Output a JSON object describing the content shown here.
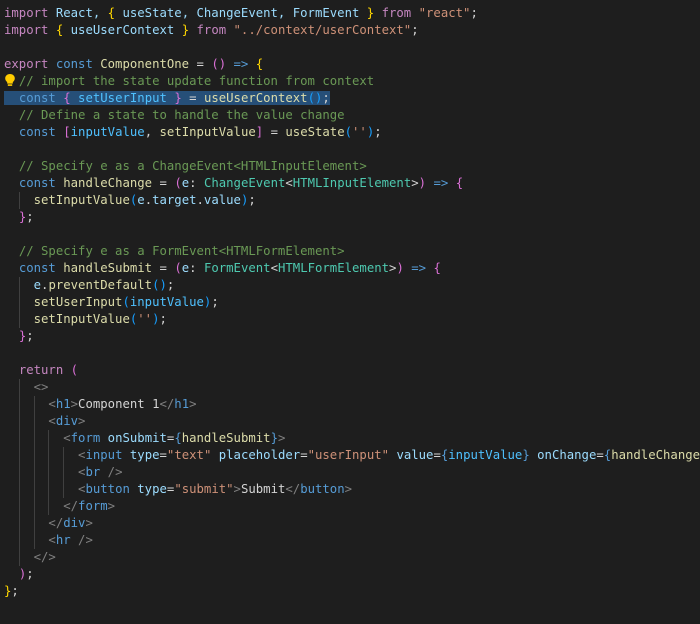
{
  "editor": {
    "lines": [
      [
        {
          "t": "import",
          "c": "kw"
        },
        {
          "t": " React, ",
          "c": "var"
        },
        {
          "t": "{",
          "c": "b1"
        },
        {
          "t": " useState, ChangeEvent, FormEvent ",
          "c": "var"
        },
        {
          "t": "}",
          "c": "b1"
        },
        {
          "t": " from ",
          "c": "kw"
        },
        {
          "t": "\"react\"",
          "c": "str"
        },
        {
          "t": ";",
          "c": "pn"
        }
      ],
      [
        {
          "t": "import",
          "c": "kw"
        },
        {
          "t": " ",
          "c": "pn"
        },
        {
          "t": "{",
          "c": "b1"
        },
        {
          "t": " useUserContext ",
          "c": "var"
        },
        {
          "t": "}",
          "c": "b1"
        },
        {
          "t": " from ",
          "c": "kw"
        },
        {
          "t": "\"../context/userContext\"",
          "c": "str"
        },
        {
          "t": ";",
          "c": "pn"
        }
      ],
      [],
      [
        {
          "t": "export",
          "c": "kw"
        },
        {
          "t": " const ",
          "c": "st"
        },
        {
          "t": "ComponentOne",
          "c": "fn"
        },
        {
          "t": " = ",
          "c": "pn"
        },
        {
          "t": "()",
          "c": "b2"
        },
        {
          "t": " => ",
          "c": "st"
        },
        {
          "t": "{",
          "c": "b1"
        }
      ],
      [
        {
          "t": "  ",
          "c": "pn",
          "bulb": true
        },
        {
          "t": "// import the state update function from context",
          "c": "cm"
        }
      ],
      [
        {
          "t": "  ",
          "c": "pn",
          "sel": true
        },
        {
          "t": "const",
          "c": "st",
          "sel": true
        },
        {
          "t": " ",
          "c": "pn",
          "sel": true
        },
        {
          "t": "{",
          "c": "b2",
          "sel": true
        },
        {
          "t": " setUserInput ",
          "c": "cst",
          "sel": true
        },
        {
          "t": "}",
          "c": "b2",
          "sel": true
        },
        {
          "t": " = ",
          "c": "pn",
          "sel": true
        },
        {
          "t": "useUserContext",
          "c": "fn",
          "sel": true
        },
        {
          "t": "()",
          "c": "b3",
          "sel": true
        },
        {
          "t": ";",
          "c": "pn",
          "sel": true
        }
      ],
      [
        {
          "t": "  ",
          "c": "pn"
        },
        {
          "t": "// Define a state to handle the value change",
          "c": "cm"
        }
      ],
      [
        {
          "t": "  ",
          "c": "pn"
        },
        {
          "t": "const",
          "c": "st"
        },
        {
          "t": " ",
          "c": "pn"
        },
        {
          "t": "[",
          "c": "b2"
        },
        {
          "t": "inputValue",
          "c": "cst"
        },
        {
          "t": ", ",
          "c": "pn"
        },
        {
          "t": "setInputValue",
          "c": "fn"
        },
        {
          "t": "]",
          "c": "b2"
        },
        {
          "t": " = ",
          "c": "pn"
        },
        {
          "t": "useState",
          "c": "fn"
        },
        {
          "t": "(",
          "c": "b3"
        },
        {
          "t": "''",
          "c": "str"
        },
        {
          "t": ")",
          "c": "b3"
        },
        {
          "t": ";",
          "c": "pn"
        }
      ],
      [],
      [
        {
          "t": "  ",
          "c": "pn"
        },
        {
          "t": "// Specify e as a ChangeEvent<HTMLInputElement>",
          "c": "cm"
        }
      ],
      [
        {
          "t": "  ",
          "c": "pn"
        },
        {
          "t": "const",
          "c": "st"
        },
        {
          "t": " ",
          "c": "pn"
        },
        {
          "t": "handleChange",
          "c": "fn"
        },
        {
          "t": " = ",
          "c": "pn"
        },
        {
          "t": "(",
          "c": "b2"
        },
        {
          "t": "e",
          "c": "var"
        },
        {
          "t": ": ",
          "c": "pn"
        },
        {
          "t": "ChangeEvent",
          "c": "ty"
        },
        {
          "t": "<",
          "c": "pn"
        },
        {
          "t": "HTMLInputElement",
          "c": "ty"
        },
        {
          "t": ">",
          "c": "pn"
        },
        {
          "t": ")",
          "c": "b2"
        },
        {
          "t": " => ",
          "c": "st"
        },
        {
          "t": "{",
          "c": "b2"
        }
      ],
      [
        {
          "t": "    ",
          "c": "pn"
        },
        {
          "t": "setInputValue",
          "c": "fn"
        },
        {
          "t": "(",
          "c": "b3"
        },
        {
          "t": "e",
          "c": "var"
        },
        {
          "t": ".",
          "c": "pn"
        },
        {
          "t": "target",
          "c": "var"
        },
        {
          "t": ".",
          "c": "pn"
        },
        {
          "t": "value",
          "c": "var"
        },
        {
          "t": ")",
          "c": "b3"
        },
        {
          "t": ";",
          "c": "pn"
        }
      ],
      [
        {
          "t": "  ",
          "c": "pn"
        },
        {
          "t": "}",
          "c": "b2"
        },
        {
          "t": ";",
          "c": "pn"
        }
      ],
      [],
      [
        {
          "t": "  ",
          "c": "pn"
        },
        {
          "t": "// Specify e as a FormEvent<HTMLFormElement>",
          "c": "cm"
        }
      ],
      [
        {
          "t": "  ",
          "c": "pn"
        },
        {
          "t": "const",
          "c": "st"
        },
        {
          "t": " ",
          "c": "pn"
        },
        {
          "t": "handleSubmit",
          "c": "fn"
        },
        {
          "t": " = ",
          "c": "pn"
        },
        {
          "t": "(",
          "c": "b2"
        },
        {
          "t": "e",
          "c": "var"
        },
        {
          "t": ": ",
          "c": "pn"
        },
        {
          "t": "FormEvent",
          "c": "ty"
        },
        {
          "t": "<",
          "c": "pn"
        },
        {
          "t": "HTMLFormElement",
          "c": "ty"
        },
        {
          "t": ">",
          "c": "pn"
        },
        {
          "t": ")",
          "c": "b2"
        },
        {
          "t": " => ",
          "c": "st"
        },
        {
          "t": "{",
          "c": "b2"
        }
      ],
      [
        {
          "t": "    ",
          "c": "pn"
        },
        {
          "t": "e",
          "c": "var"
        },
        {
          "t": ".",
          "c": "pn"
        },
        {
          "t": "preventDefault",
          "c": "fn"
        },
        {
          "t": "()",
          "c": "b3"
        },
        {
          "t": ";",
          "c": "pn"
        }
      ],
      [
        {
          "t": "    ",
          "c": "pn"
        },
        {
          "t": "setUserInput",
          "c": "fn"
        },
        {
          "t": "(",
          "c": "b3"
        },
        {
          "t": "inputValue",
          "c": "cst"
        },
        {
          "t": ")",
          "c": "b3"
        },
        {
          "t": ";",
          "c": "pn"
        }
      ],
      [
        {
          "t": "    ",
          "c": "pn"
        },
        {
          "t": "setInputValue",
          "c": "fn"
        },
        {
          "t": "(",
          "c": "b3"
        },
        {
          "t": "''",
          "c": "str"
        },
        {
          "t": ")",
          "c": "b3"
        },
        {
          "t": ";",
          "c": "pn"
        }
      ],
      [
        {
          "t": "  ",
          "c": "pn"
        },
        {
          "t": "}",
          "c": "b2"
        },
        {
          "t": ";",
          "c": "pn"
        }
      ],
      [],
      [
        {
          "t": "  ",
          "c": "pn"
        },
        {
          "t": "return",
          "c": "kw"
        },
        {
          "t": " ",
          "c": "pn"
        },
        {
          "t": "(",
          "c": "b2"
        }
      ],
      [
        {
          "t": "    ",
          "c": "pn"
        },
        {
          "t": "<>",
          "c": "tag"
        }
      ],
      [
        {
          "t": "      ",
          "c": "pn"
        },
        {
          "t": "<",
          "c": "tag"
        },
        {
          "t": "h1",
          "c": "tn"
        },
        {
          "t": ">",
          "c": "tag"
        },
        {
          "t": "Component 1",
          "c": "pn"
        },
        {
          "t": "</",
          "c": "tag"
        },
        {
          "t": "h1",
          "c": "tn"
        },
        {
          "t": ">",
          "c": "tag"
        }
      ],
      [
        {
          "t": "      ",
          "c": "pn"
        },
        {
          "t": "<",
          "c": "tag"
        },
        {
          "t": "div",
          "c": "tn"
        },
        {
          "t": ">",
          "c": "tag"
        }
      ],
      [
        {
          "t": "        ",
          "c": "pn"
        },
        {
          "t": "<",
          "c": "tag"
        },
        {
          "t": "form",
          "c": "tn"
        },
        {
          "t": " ",
          "c": "pn"
        },
        {
          "t": "onSubmit",
          "c": "at"
        },
        {
          "t": "=",
          "c": "pn"
        },
        {
          "t": "{",
          "c": "st"
        },
        {
          "t": "handleSubmit",
          "c": "fn"
        },
        {
          "t": "}",
          "c": "st"
        },
        {
          "t": ">",
          "c": "tag"
        }
      ],
      [
        {
          "t": "          ",
          "c": "pn"
        },
        {
          "t": "<",
          "c": "tag"
        },
        {
          "t": "input",
          "c": "tn"
        },
        {
          "t": " ",
          "c": "pn"
        },
        {
          "t": "type",
          "c": "at"
        },
        {
          "t": "=",
          "c": "pn"
        },
        {
          "t": "\"text\"",
          "c": "str"
        },
        {
          "t": " ",
          "c": "pn"
        },
        {
          "t": "placeholder",
          "c": "at"
        },
        {
          "t": "=",
          "c": "pn"
        },
        {
          "t": "\"userInput\"",
          "c": "str"
        },
        {
          "t": " ",
          "c": "pn"
        },
        {
          "t": "value",
          "c": "at"
        },
        {
          "t": "=",
          "c": "pn"
        },
        {
          "t": "{",
          "c": "st"
        },
        {
          "t": "inputValue",
          "c": "cst"
        },
        {
          "t": "}",
          "c": "st"
        },
        {
          "t": " ",
          "c": "pn"
        },
        {
          "t": "onChange",
          "c": "at"
        },
        {
          "t": "=",
          "c": "pn"
        },
        {
          "t": "{",
          "c": "st"
        },
        {
          "t": "handleChange",
          "c": "fn"
        },
        {
          "t": "}",
          "c": "st"
        },
        {
          "t": " ",
          "c": "pn"
        },
        {
          "t": "/>",
          "c": "tag"
        }
      ],
      [
        {
          "t": "          ",
          "c": "pn"
        },
        {
          "t": "<",
          "c": "tag"
        },
        {
          "t": "br",
          "c": "tn"
        },
        {
          "t": " ",
          "c": "pn"
        },
        {
          "t": "/>",
          "c": "tag"
        }
      ],
      [
        {
          "t": "          ",
          "c": "pn"
        },
        {
          "t": "<",
          "c": "tag"
        },
        {
          "t": "button",
          "c": "tn"
        },
        {
          "t": " ",
          "c": "pn"
        },
        {
          "t": "type",
          "c": "at"
        },
        {
          "t": "=",
          "c": "pn"
        },
        {
          "t": "\"submit\"",
          "c": "str"
        },
        {
          "t": ">",
          "c": "tag"
        },
        {
          "t": "Submit",
          "c": "pn"
        },
        {
          "t": "</",
          "c": "tag"
        },
        {
          "t": "button",
          "c": "tn"
        },
        {
          "t": ">",
          "c": "tag"
        }
      ],
      [
        {
          "t": "        ",
          "c": "pn"
        },
        {
          "t": "</",
          "c": "tag"
        },
        {
          "t": "form",
          "c": "tn"
        },
        {
          "t": ">",
          "c": "tag"
        }
      ],
      [
        {
          "t": "      ",
          "c": "pn"
        },
        {
          "t": "</",
          "c": "tag"
        },
        {
          "t": "div",
          "c": "tn"
        },
        {
          "t": ">",
          "c": "tag"
        }
      ],
      [
        {
          "t": "      ",
          "c": "pn"
        },
        {
          "t": "<",
          "c": "tag"
        },
        {
          "t": "hr",
          "c": "tn"
        },
        {
          "t": " ",
          "c": "pn"
        },
        {
          "t": "/>",
          "c": "tag"
        }
      ],
      [
        {
          "t": "    ",
          "c": "pn"
        },
        {
          "t": "</>",
          "c": "tag"
        }
      ],
      [
        {
          "t": "  ",
          "c": "pn"
        },
        {
          "t": ")",
          "c": "b2"
        },
        {
          "t": ";",
          "c": "pn"
        }
      ],
      [
        {
          "t": "}",
          "c": "b1"
        },
        {
          "t": ";",
          "c": "pn"
        }
      ]
    ]
  }
}
